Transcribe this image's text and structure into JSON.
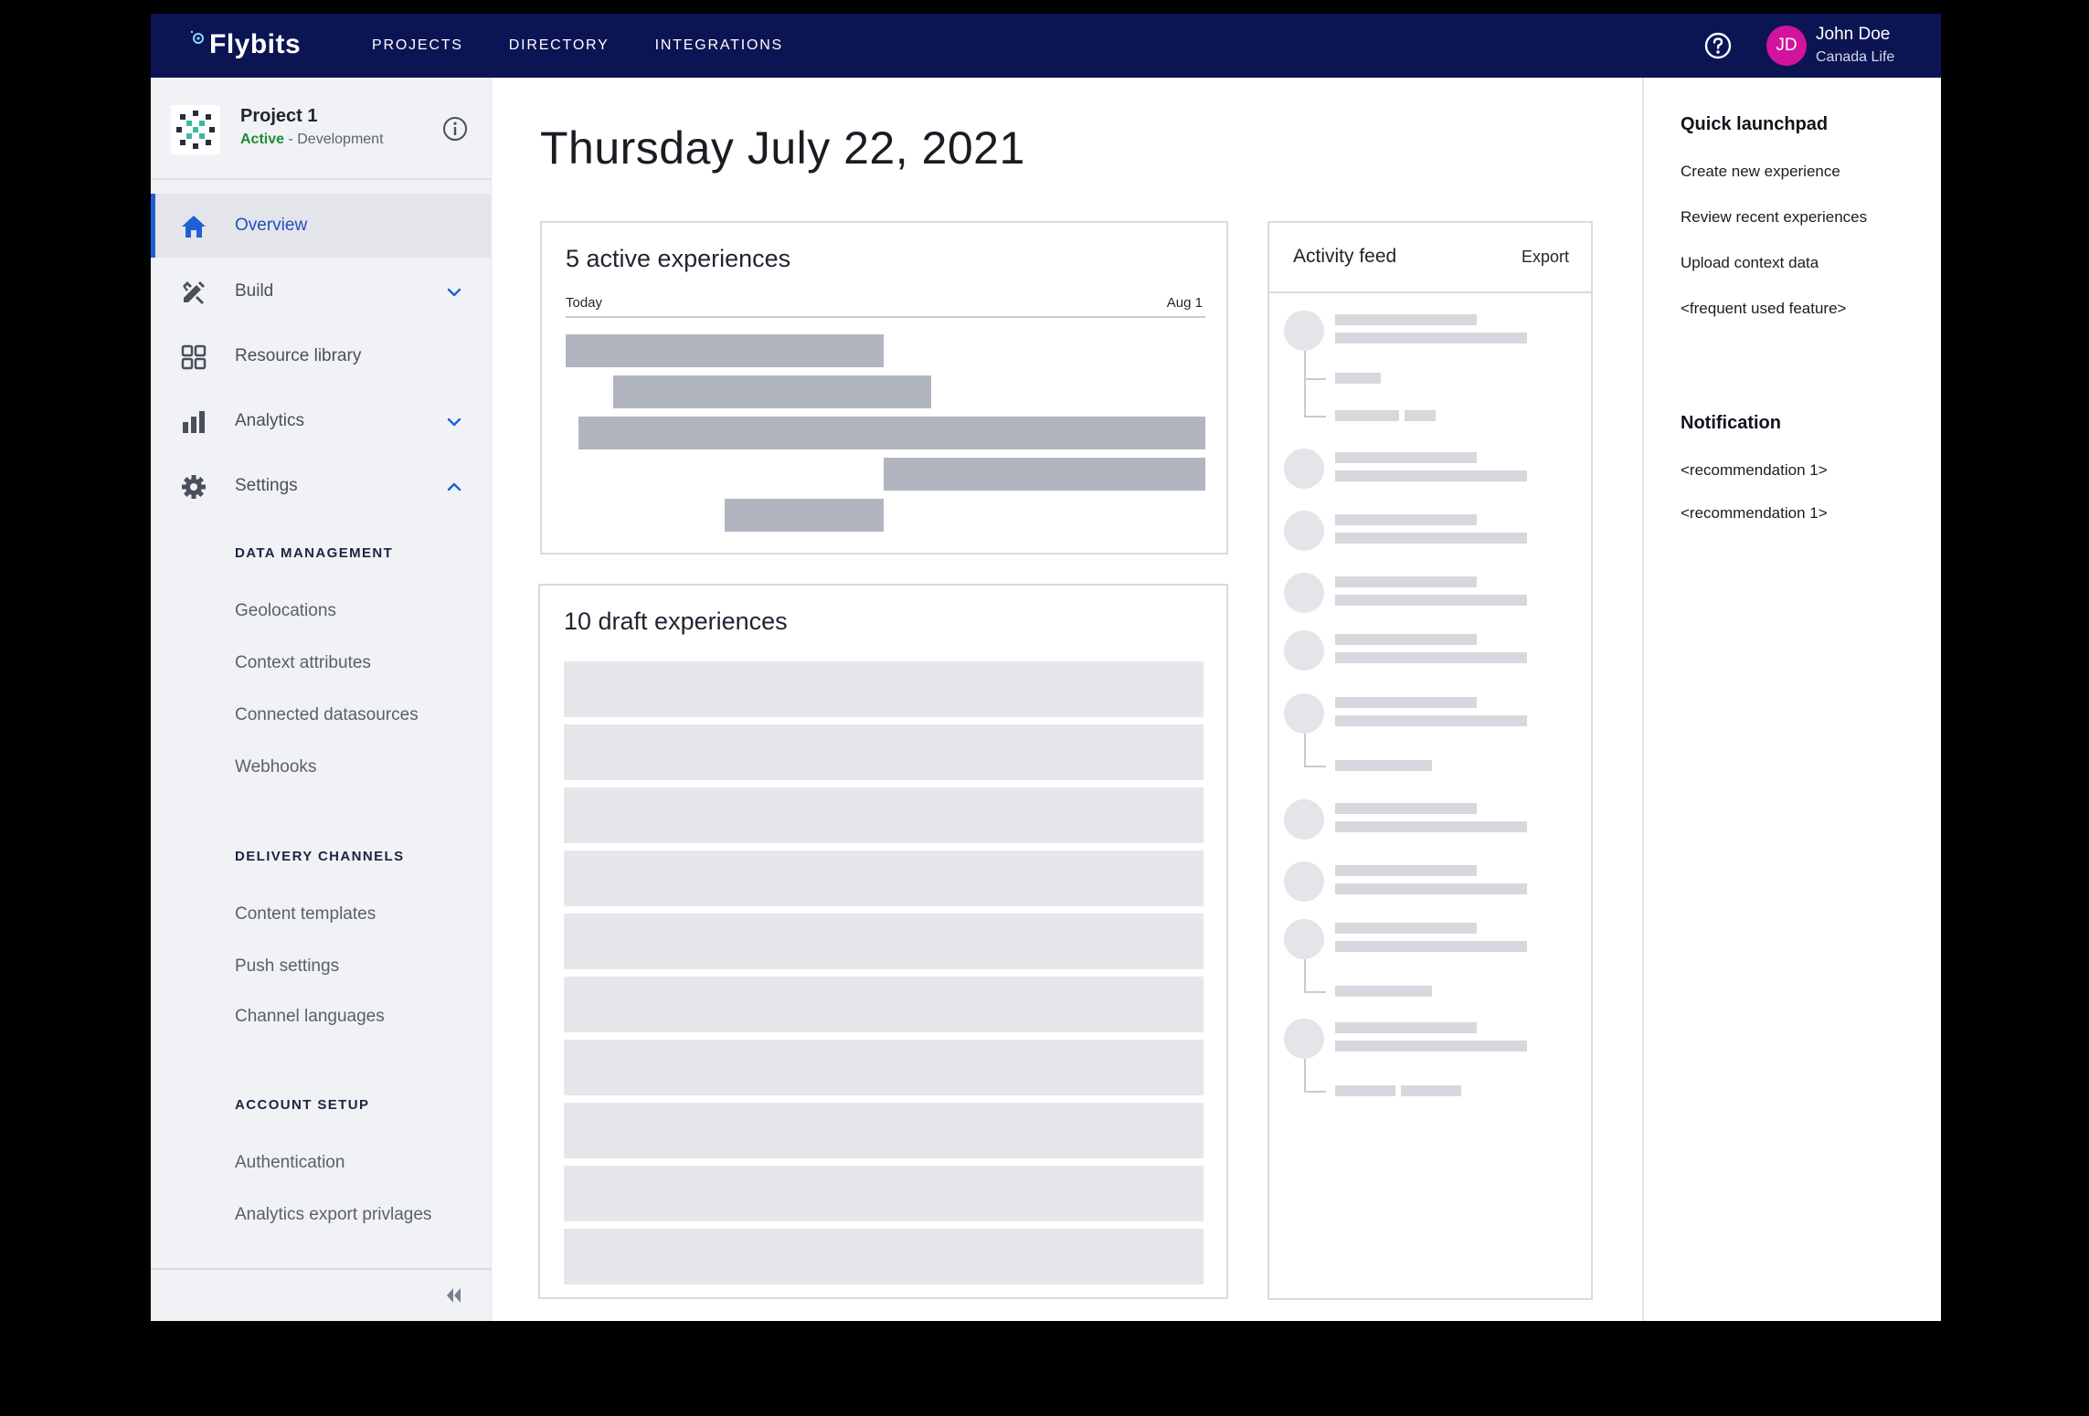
{
  "app": {
    "brand": "Flybits"
  },
  "nav": {
    "items": [
      "PROJECTS",
      "DIRECTORY",
      "INTEGRATIONS"
    ]
  },
  "user": {
    "initials": "JD",
    "name": "John Doe",
    "org": "Canada Life"
  },
  "project": {
    "name": "Project 1",
    "status": "Active",
    "environment": " - Development"
  },
  "sidebar": {
    "menu": [
      {
        "label": "Overview",
        "icon": "home-icon",
        "active": true
      },
      {
        "label": "Build",
        "icon": "build-icon",
        "chevron": "down"
      },
      {
        "label": "Resource library",
        "icon": "grid-icon"
      },
      {
        "label": "Analytics",
        "icon": "bar-chart-icon",
        "chevron": "down"
      },
      {
        "label": "Settings",
        "icon": "gear-icon",
        "chevron": "up"
      }
    ],
    "sections": [
      {
        "title": "DATA MANAGEMENT",
        "items": [
          "Geolocations",
          "Context attributes",
          "Connected datasources",
          "Webhooks"
        ]
      },
      {
        "title": "DELIVERY CHANNELS",
        "items": [
          "Content templates",
          "Push settings",
          "Channel languages"
        ]
      },
      {
        "title": "ACCOUNT SETUP",
        "items": [
          "Authentication",
          "Analytics export privlages"
        ]
      }
    ]
  },
  "main": {
    "date": "Thursday July 22, 2021",
    "active_card": {
      "title": "5 active experiences",
      "start_label": "Today",
      "end_label": "Aug 1"
    },
    "draft_card": {
      "title": "10 draft experiences"
    }
  },
  "feed": {
    "title": "Activity feed",
    "export_label": "Export"
  },
  "right_panel": {
    "quick_title": "Quick launchpad",
    "quick_links": [
      "Create new experience",
      "Review recent experiences",
      "Upload context data",
      "<frequent used feature>"
    ],
    "notif_title": "Notification",
    "notifications": [
      "<recommendation 1>",
      "<recommendation 1>"
    ]
  },
  "colors": {
    "topbar": "#0b1553",
    "accent": "#1f5fd6",
    "avatar": "#d1139d",
    "active_status": "#1e8c3a"
  }
}
